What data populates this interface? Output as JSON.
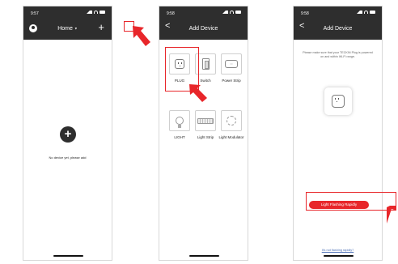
{
  "screens": [
    {
      "time": "9:57",
      "title": "Home",
      "plus": "+",
      "center_plus": "+",
      "empty_text": "No device yet, please add"
    },
    {
      "time": "9:58",
      "back": "<",
      "title": "Add Device",
      "devices": [
        {
          "label": "PLUG",
          "icon": "plug-icon"
        },
        {
          "label": "Switch",
          "icon": "switch-icon"
        },
        {
          "label": "Power Strip",
          "icon": "power-strip-icon"
        },
        {
          "label": "LIGHT",
          "icon": "bulb-icon"
        },
        {
          "label": "Light Strip",
          "icon": "light-strip-icon"
        },
        {
          "label": "Light Modulator",
          "icon": "light-modulator-icon"
        }
      ]
    },
    {
      "time": "9:58",
      "back": "<",
      "title": "Add Device",
      "instructions": "Please make sure that your TECKIN Plug is powered on and within Wi-Fi range.",
      "button": "Light Flashing Rapidly",
      "link": "It's not flashing rapidly?"
    }
  ],
  "colors": {
    "accent": "#e8262a",
    "header": "#2e2e2e",
    "link": "#4b6fb6"
  }
}
